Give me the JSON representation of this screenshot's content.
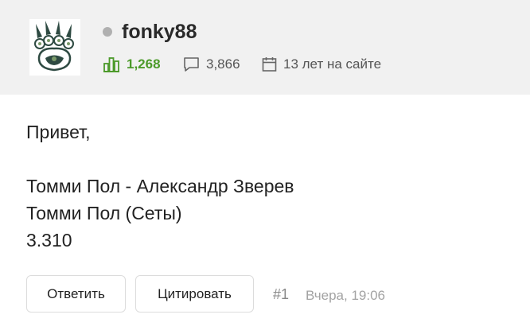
{
  "user": {
    "name": "fonky88",
    "status": "offline",
    "rating": "1,268",
    "comments": "3,866",
    "member_since": "13 лет на сайте"
  },
  "post": {
    "lines": [
      "Привет,",
      "",
      "Томми Пол - Александр Зверев",
      "Томми Пол (Сеты)",
      "3.310"
    ]
  },
  "actions": {
    "reply_label": "Ответить",
    "quote_label": "Цитировать"
  },
  "meta": {
    "number": "#1",
    "time": "Вчера, 19:06"
  },
  "icons": {
    "avatar": "bear-paw-logo",
    "rating": "bar-chart-icon",
    "comments": "speech-bubble-icon",
    "member_since": "calendar-icon"
  },
  "colors": {
    "header_bg": "#f1f1f1",
    "rating_green": "#4c9a2a",
    "status_dot": "#b0b0b0",
    "muted_text": "#a3a3a3"
  }
}
